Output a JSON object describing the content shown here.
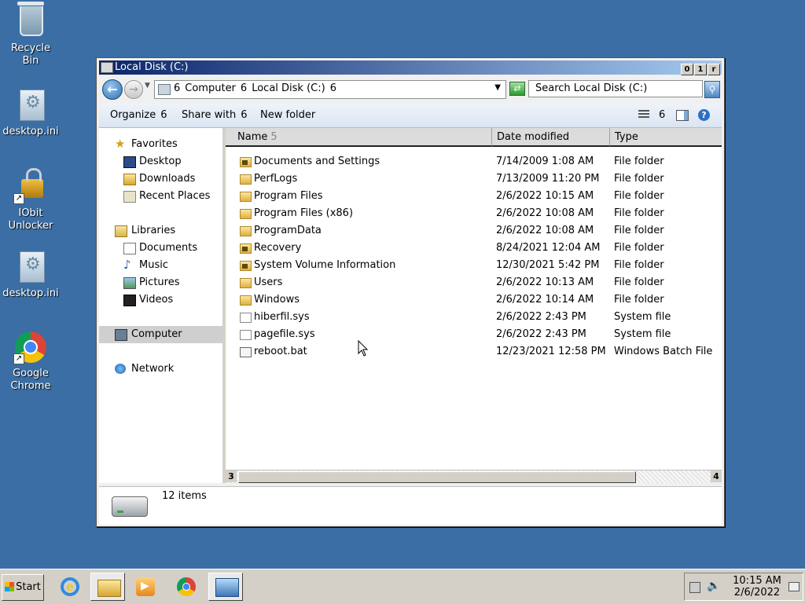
{
  "desktop": {
    "icons": [
      {
        "label": "Recycle\nBin",
        "icon": "recycle-bin-icon"
      },
      {
        "label": "desktop.ini",
        "icon": "ini-file-icon"
      },
      {
        "label": "IObit\nUnlocker",
        "icon": "iobit-unlocker-icon"
      },
      {
        "label": "desktop.ini",
        "icon": "ini-file-icon"
      },
      {
        "label": "Google\nChrome",
        "icon": "chrome-icon"
      }
    ]
  },
  "window": {
    "title": "Local Disk (C:)",
    "controls": {
      "minimize": "0",
      "maximize": "1",
      "close": "r"
    },
    "address": {
      "crumbs": [
        "6",
        "Computer",
        "6",
        "Local Disk (C:)",
        "6"
      ]
    },
    "search_placeholder": "Search Local Disk (C:)",
    "toolbar": {
      "organize": "Organize",
      "organize_arrow": "6",
      "share": "Share with",
      "share_arrow": "6",
      "new_folder": "New folder",
      "views_arrow": "6",
      "help": "?"
    },
    "nav": {
      "favorites": "Favorites",
      "desktop": "Desktop",
      "downloads": "Downloads",
      "recent": "Recent Places",
      "libraries": "Libraries",
      "documents": "Documents",
      "music": "Music",
      "pictures": "Pictures",
      "videos": "Videos",
      "computer": "Computer",
      "network": "Network"
    },
    "columns": {
      "name": "Name",
      "name_sort": "5",
      "date": "Date modified",
      "type": "Type"
    },
    "files": [
      {
        "name": "Documents and Settings",
        "date": "7/14/2009 1:08 AM",
        "type": "File folder"
      },
      {
        "name": "PerfLogs",
        "date": "7/13/2009 11:20 PM",
        "type": "File folder"
      },
      {
        "name": "Program Files",
        "date": "2/6/2022 10:15 AM",
        "type": "File folder"
      },
      {
        "name": "Program Files (x86)",
        "date": "2/6/2022 10:08 AM",
        "type": "File folder"
      },
      {
        "name": "ProgramData",
        "date": "2/6/2022 10:08 AM",
        "type": "File folder"
      },
      {
        "name": "Recovery",
        "date": "8/24/2021 12:04 AM",
        "type": "File folder"
      },
      {
        "name": "System Volume Information",
        "date": "12/30/2021 5:42 PM",
        "type": "File folder"
      },
      {
        "name": "Users",
        "date": "2/6/2022 10:13 AM",
        "type": "File folder"
      },
      {
        "name": "Windows",
        "date": "2/6/2022 10:14 AM",
        "type": "File folder"
      },
      {
        "name": "hiberfil.sys",
        "date": "2/6/2022 2:43 PM",
        "type": "System file"
      },
      {
        "name": "pagefile.sys",
        "date": "2/6/2022 2:43 PM",
        "type": "System file"
      },
      {
        "name": "reboot.bat",
        "date": "12/23/2021 12:58 PM",
        "type": "Windows Batch File"
      }
    ],
    "scroll": {
      "left": "3",
      "right": "4"
    },
    "status": {
      "item_count": "12 items"
    }
  },
  "taskbar": {
    "start": "Start",
    "apps": [
      "internet-explorer-icon",
      "windows-explorer-icon",
      "media-player-icon",
      "chrome-icon",
      "remote-desktop-icon"
    ],
    "time": "10:15 AM",
    "date": "2/6/2022"
  }
}
